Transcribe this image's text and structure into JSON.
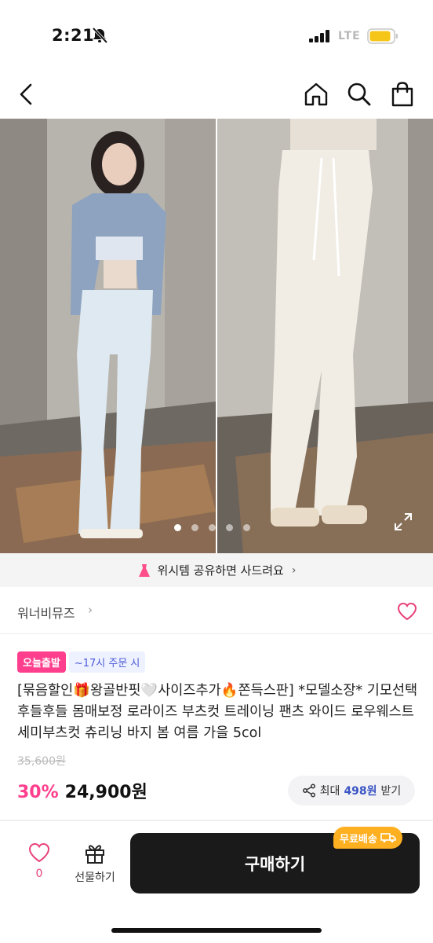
{
  "status_bar": {
    "time": "2:21",
    "network": "LTE",
    "icons": [
      "mute-icon",
      "signal-icon",
      "battery-icon"
    ],
    "battery_color": "#f5c518"
  },
  "nav": {
    "icons": [
      "back-arrow-icon",
      "home-icon",
      "search-icon",
      "shopping-bag-icon"
    ]
  },
  "carousel": {
    "total_slides": 5,
    "active_index": 0,
    "icons": [
      "expand-icon"
    ]
  },
  "wish_banner": {
    "text": "위시템 공유하면 사드려요",
    "chevron": "›",
    "icon": "dress-icon",
    "icon_color": "#ff4f8b"
  },
  "shop": {
    "name": "워너비뮤즈",
    "chevron": "›",
    "icon": "heart-outline-icon"
  },
  "badges": {
    "today_shipping": "오늘출발",
    "order_cutoff": "~17시 주문 시"
  },
  "product": {
    "title": "[묶음할인🎁왕골반핏🤍사이즈추가🔥쫀득스판] *모델소장* 기모선택 후들후들 몸매보정 로라이즈 부츠컷 트레이닝 팬츠 와이드 로우웨스트 세미부츠컷 츄리닝 바지 봄 여름 가을 5col",
    "original_price": "35,600원",
    "discount": "30%",
    "price": "24,900원"
  },
  "points": {
    "prefix": "최대",
    "amount": "498원",
    "suffix": "받기",
    "icon": "share-icon"
  },
  "bottom_bar": {
    "like_count": "0",
    "gift_label": "선물하기",
    "buy_label": "구매하기",
    "free_shipping": "무료배송",
    "icons": [
      "heart-outline-icon",
      "gift-icon",
      "truck-icon"
    ]
  },
  "colors": {
    "accent_pink": "#ff3f8d",
    "points_blue": "#3a55c4",
    "buy_button": "#1a1a1a",
    "free_shipping": "#ffb020"
  }
}
